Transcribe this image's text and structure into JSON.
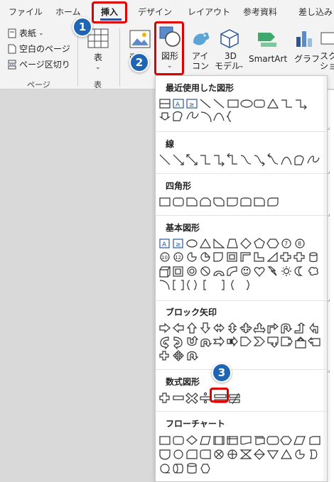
{
  "tabs": [
    {
      "label": "ファイル"
    },
    {
      "label": "ホーム"
    },
    {
      "label": "挿入"
    },
    {
      "label": "デザイン"
    },
    {
      "label": "レイアウト"
    },
    {
      "label": "参考資料"
    },
    {
      "label": "差し込み"
    }
  ],
  "ribbon": {
    "page_group": {
      "cover_page": "表紙",
      "blank_page": "空白のページ",
      "page_break": "ページ区切り",
      "group_label": "ページ"
    },
    "table_group": {
      "table": "表",
      "group_label": "表"
    },
    "illustrations": {
      "pictures": "画像",
      "shapes": "図形",
      "icons_line1": "アイ",
      "icons_line2": "コン",
      "models_line1": "3D",
      "models_line2": "モデル",
      "smartart": "SmartArt",
      "chart": "グラフ",
      "screenshot_line1": "スク",
      "screenshot_line2": "ショ"
    }
  },
  "shapes_menu": {
    "sections": [
      {
        "title": "最近使用した図形"
      },
      {
        "title": "線"
      },
      {
        "title": "四角形"
      },
      {
        "title": "基本図形"
      },
      {
        "title": "ブロック矢印"
      },
      {
        "title": "数式図形"
      },
      {
        "title": "フローチャート"
      }
    ]
  },
  "callouts": [
    "1",
    "2",
    "3"
  ],
  "colors": {
    "callout_blue": "#1e66b4",
    "highlight_red": "#e00000",
    "tab_accent": "#2b579a"
  }
}
